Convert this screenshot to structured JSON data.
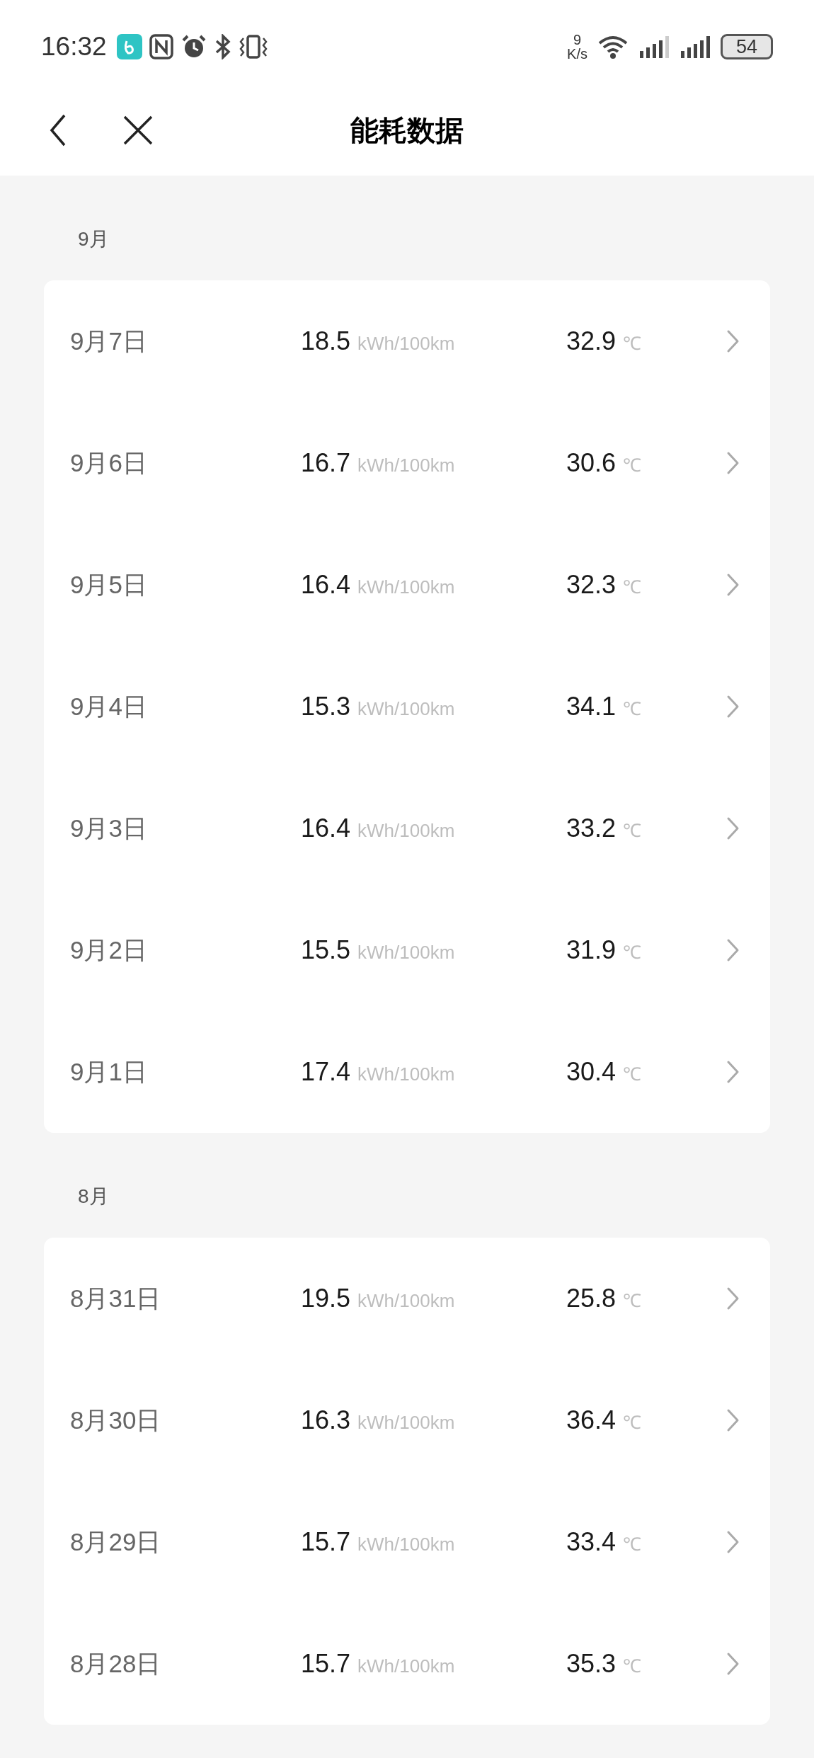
{
  "status_bar": {
    "time": "16:32",
    "net_speed_value": "9",
    "net_speed_unit": "K/s",
    "battery": "54"
  },
  "header": {
    "title": "能耗数据"
  },
  "sections": [
    {
      "month": "9月",
      "rows": [
        {
          "date": "9月7日",
          "consumption": "18.5",
          "consumption_unit": "kWh/100km",
          "temperature": "32.9",
          "temperature_unit": "℃"
        },
        {
          "date": "9月6日",
          "consumption": "16.7",
          "consumption_unit": "kWh/100km",
          "temperature": "30.6",
          "temperature_unit": "℃"
        },
        {
          "date": "9月5日",
          "consumption": "16.4",
          "consumption_unit": "kWh/100km",
          "temperature": "32.3",
          "temperature_unit": "℃"
        },
        {
          "date": "9月4日",
          "consumption": "15.3",
          "consumption_unit": "kWh/100km",
          "temperature": "34.1",
          "temperature_unit": "℃"
        },
        {
          "date": "9月3日",
          "consumption": "16.4",
          "consumption_unit": "kWh/100km",
          "temperature": "33.2",
          "temperature_unit": "℃"
        },
        {
          "date": "9月2日",
          "consumption": "15.5",
          "consumption_unit": "kWh/100km",
          "temperature": "31.9",
          "temperature_unit": "℃"
        },
        {
          "date": "9月1日",
          "consumption": "17.4",
          "consumption_unit": "kWh/100km",
          "temperature": "30.4",
          "temperature_unit": "℃"
        }
      ]
    },
    {
      "month": "8月",
      "rows": [
        {
          "date": "8月31日",
          "consumption": "19.5",
          "consumption_unit": "kWh/100km",
          "temperature": "25.8",
          "temperature_unit": "℃"
        },
        {
          "date": "8月30日",
          "consumption": "16.3",
          "consumption_unit": "kWh/100km",
          "temperature": "36.4",
          "temperature_unit": "℃"
        },
        {
          "date": "8月29日",
          "consumption": "15.7",
          "consumption_unit": "kWh/100km",
          "temperature": "33.4",
          "temperature_unit": "℃"
        },
        {
          "date": "8月28日",
          "consumption": "15.7",
          "consumption_unit": "kWh/100km",
          "temperature": "35.3",
          "temperature_unit": "℃"
        }
      ]
    }
  ]
}
